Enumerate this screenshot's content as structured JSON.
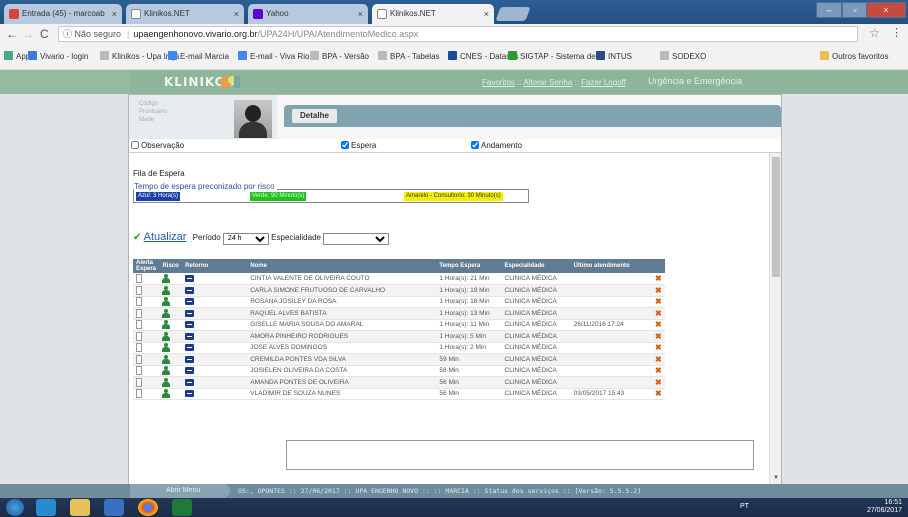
{
  "browser": {
    "tabs": [
      {
        "label": "Entrada (45) - marcoab",
        "icon": "gmail-icon",
        "color": "#d44638"
      },
      {
        "label": "Klinikos.NET",
        "icon": "page-icon",
        "color": "#9aa"
      },
      {
        "label": "Yahoo",
        "icon": "yahoo-icon",
        "color": "#5f01d1"
      },
      {
        "label": "Klinikos.NET",
        "icon": "page-icon",
        "color": "#9aa"
      }
    ],
    "address": {
      "security_label": "ⓘ Não seguro",
      "host": "upaengenhonovo.vivario.org.br",
      "path": "/UPA24H/UPA/AtendimentoMedico.aspx"
    },
    "bookmarks": [
      {
        "label": "Apps",
        "color": "#4a8"
      },
      {
        "label": "Vivario - login",
        "color": "#3a7fcf"
      },
      {
        "label": "Klinikos - Upa Irajá",
        "color": "#bbb"
      },
      {
        "label": "E-mail Marcia",
        "color": "#4285f4"
      },
      {
        "label": "E-mail - Viva Rio",
        "color": "#4285f4"
      },
      {
        "label": "BPA - Versão",
        "color": "#bbb"
      },
      {
        "label": "BPA - Tabelas",
        "color": "#bbb"
      },
      {
        "label": "CNES - Datasus",
        "color": "#1a4aa0"
      },
      {
        "label": "SIGTAP - Sistema de",
        "color": "#2a9a2a"
      },
      {
        "label": "INTUS",
        "color": "#2a4a8a"
      },
      {
        "label": "SODEXO",
        "color": "#bbb"
      },
      {
        "label": "Outros favoritos",
        "color": "#e8c14a"
      }
    ]
  },
  "header": {
    "logo": "KLINIKOS",
    "links": {
      "favoritos": "Favoritos",
      "alterar_senha": "Alterar Senha",
      "fazer_logoff": "Fazer Logoff"
    },
    "unit": "Urgência e Emergência"
  },
  "profile": {
    "fields": [
      "Código",
      "Prontuário",
      "Idade"
    ]
  },
  "panel": {
    "tab_label": "Detalhe"
  },
  "filters": {
    "observacao": "Observação",
    "espera": "Espera",
    "andamento": "Andamento"
  },
  "queue": {
    "title": "Fila de Espera",
    "legend_title": "Tempo de espera preconizado por risco",
    "legend": [
      {
        "label": "Azul: 3 Hora(s)",
        "bg": "#1d3fa8",
        "fg": "#ffffff"
      },
      {
        "label": "Verde: 90 Minuto(s)",
        "bg": "#22c022",
        "fg": "#d8ffd8"
      },
      {
        "label": "Amarelo - Consultorio: 30 Minuto(s)",
        "bg": "#f2f200",
        "fg": "#333333"
      }
    ],
    "refresh_label": "Atualizar",
    "period_label": "Período",
    "period_value": "24 h",
    "specialty_label": "Especialidade",
    "specialty_value": "",
    "columns": [
      "Alerta Espera",
      "Risco",
      "Retorno",
      "",
      "Nome",
      "Tempo Espera",
      "Especialidade",
      "Último atendimento",
      ""
    ],
    "rows": [
      {
        "nome": "CINTIA VALENTE DE OLIVEIRA COUTO",
        "tempo": "1 Hora(s): 21 Min",
        "esp": "CLINICA MÉDICA",
        "ultimo": ""
      },
      {
        "nome": "CARLA SIMONE FRUTUOSO DE CARVALHO",
        "tempo": "1 Hora(s): 19 Min",
        "esp": "CLINICA MÉDICA",
        "ultimo": ""
      },
      {
        "nome": "ROSANA JOSILEY DA ROSA",
        "tempo": "1 Hora(s): 18 Min",
        "esp": "CLINICA MÉDICA",
        "ultimo": ""
      },
      {
        "nome": "RAQUEL ALVES BATISTA",
        "tempo": "1 Hora(s): 13 Min",
        "esp": "CLINICA MÉDICA",
        "ultimo": ""
      },
      {
        "nome": "GISELLE MARIA SOUSA DO AMARAL",
        "tempo": "1 Hora(s): 11 Min",
        "esp": "CLINICA MÉDICA",
        "ultimo": "26/11/2016 17:24"
      },
      {
        "nome": "AMORA PINHEIRO RODRIGUES",
        "tempo": "1 Hora(s): 5 Min",
        "esp": "CLINICA MÉDICA",
        "ultimo": ""
      },
      {
        "nome": "JOSE ALVES DOMINGOS",
        "tempo": "1 Hora(s): 2 Min",
        "esp": "CLINICA MÉDICA",
        "ultimo": ""
      },
      {
        "nome": "CREMILDA PONTES VDA SILVA",
        "tempo": "59 Min",
        "esp": "CLINICA MÉDICA",
        "ultimo": ""
      },
      {
        "nome": "JOSIELEN OLIVEIRA DA COSTA",
        "tempo": "58 Min",
        "esp": "CLINICA MÉDICA",
        "ultimo": ""
      },
      {
        "nome": "AMANDA PONTES DE OLIVEIRA",
        "tempo": "56 Min",
        "esp": "CLINICA MÉDICA",
        "ultimo": ""
      },
      {
        "nome": "VLADIMIR DE SOUZA NUNES",
        "tempo": "56 Min",
        "esp": "CLINICA MÉDICA",
        "ultimo": "03/05/2017 15:43"
      }
    ]
  },
  "statusbar": {
    "menu": "Abrir Menu",
    "text": "OS:, OPONTES :: 27/06/2017 :: UPA ENGENHO NOVO :: :: MARCIA :: Status dos serviços :: [Versão: 5.5.5.2]"
  },
  "taskbar": {
    "lang": "PT",
    "time": "16:51",
    "date": "27/06/2017"
  }
}
